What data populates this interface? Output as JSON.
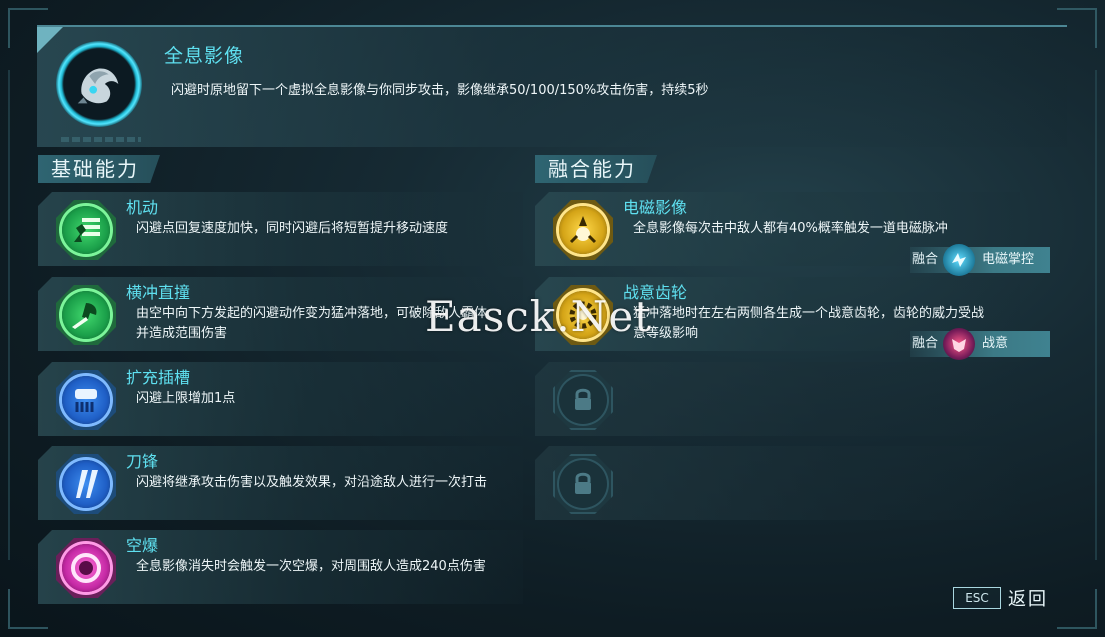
{
  "hero": {
    "title": "全息影像",
    "description": "闪避时原地留下一个虚拟全息影像与你同步攻击，影像继承50/100/150%攻击伤害，持续5秒"
  },
  "sections": {
    "basic": "基础能力",
    "fusion": "融合能力"
  },
  "basic_abilities": [
    {
      "title": "机动",
      "desc": "闪避点回复速度加快，同时闪避后将短暂提升移动速度",
      "icon": "running-figure-icon",
      "color": "#1ba04a"
    },
    {
      "title": "横冲直撞",
      "desc": "由空中向下方发起的闪避动作变为猛冲落地，可破除敌人霸体并造成范围伤害",
      "icon": "dash-strike-icon",
      "color": "#1ba04a"
    },
    {
      "title": "扩充插槽",
      "desc": "闪避上限增加1点",
      "icon": "slot-expand-icon",
      "color": "#1f5fc6"
    },
    {
      "title": "刀锋",
      "desc": "闪避将继承攻击伤害以及触发效果，对沿途敌人进行一次打击",
      "icon": "blade-icon",
      "color": "#1f5fc6"
    },
    {
      "title": "空爆",
      "desc": "全息影像消失时会触发一次空爆，对周围敌人造成240点伤害",
      "icon": "air-burst-icon",
      "color": "#c62aa6"
    }
  ],
  "fusion_abilities": [
    {
      "title": "电磁影像",
      "desc": "全息影像每次击中敌人都有40%概率触发一道电磁脉冲",
      "icon": "electromagnetic-icon",
      "color": "#d4a417",
      "fuse_label": "融合",
      "fuse_with": "电磁掌控"
    },
    {
      "title": "战意齿轮",
      "desc": "猛冲落地时在左右两侧各生成一个战意齿轮，齿轮的威力受战意等级影响",
      "icon": "gear-icon",
      "color": "#d4a417",
      "fuse_label": "融合",
      "fuse_with": "战意"
    },
    {
      "locked": true,
      "icon": "lock-icon"
    },
    {
      "locked": true,
      "icon": "lock-icon"
    }
  ],
  "footer": {
    "esc_key": "ESC",
    "back_label": "返回"
  },
  "watermark": "Easck.Net"
}
